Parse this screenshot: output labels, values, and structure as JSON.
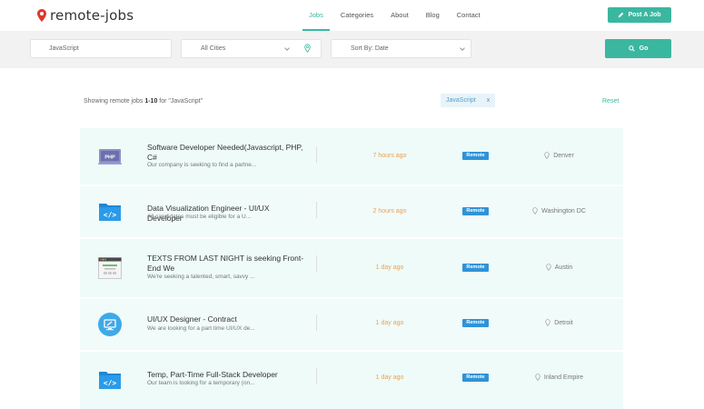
{
  "brand": {
    "logo_text": "remote-jobs",
    "accent": "#3bb7a0",
    "pin_color": "#e0362c"
  },
  "nav": {
    "items": [
      {
        "label": "Jobs",
        "active": true
      },
      {
        "label": "Categories",
        "active": false
      },
      {
        "label": "About",
        "active": false
      },
      {
        "label": "Blog",
        "active": false
      },
      {
        "label": "Contact",
        "active": false
      }
    ],
    "post_job_label": "Post A Job"
  },
  "search": {
    "keyword_value": "JavaScript",
    "city_value": "All Cities",
    "sort_value": "Sort By: Date",
    "go_label": "Go"
  },
  "results": {
    "summary_prefix": "Showing remote jobs ",
    "summary_range": "1-10",
    "summary_suffix": " for \"JavaScript\"",
    "active_filter": "JavaScript",
    "remove_filter": "x",
    "reset_label": "Reset"
  },
  "jobs": [
    {
      "icon": "php-icon",
      "title": "Software Developer Needed(Javascript, PHP, C#",
      "desc": "Our company is seeking to find a partne...",
      "time": "7 hours ago",
      "badge": "Remote",
      "location": "Denver"
    },
    {
      "icon": "code-folder-icon",
      "title": "Data Visualization Engineer - UI/UX Developer",
      "desc": "All candidates must be eligible for a U...",
      "time": "2 hours ago",
      "badge": "Remote",
      "location": "Washington DC"
    },
    {
      "icon": "browser-window-icon",
      "title": "TEXTS FROM LAST NIGHT is seeking Front-End We",
      "desc": "We're seeking a talented, smart, savvy ...",
      "time": "1 day ago",
      "badge": "Remote",
      "location": "Austin"
    },
    {
      "icon": "monitor-icon",
      "title": "UI/UX Designer - Contract",
      "desc": "We are looking for a part time UI/UX de...",
      "time": "1 day ago",
      "badge": "Remote",
      "location": "Detroit"
    },
    {
      "icon": "code-folder-icon",
      "title": "Temp, Part-Time Full-Stack Developer",
      "desc": "Our team is looking for a temporary (on...",
      "time": "1 day ago",
      "badge": "Remote",
      "location": "Inland Empire"
    }
  ]
}
